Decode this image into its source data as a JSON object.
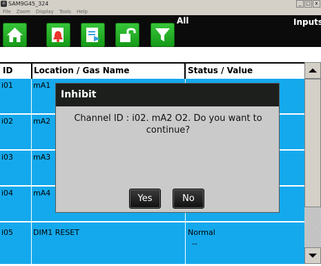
{
  "window": {
    "title": "SAM9G45_324",
    "minimize": "_",
    "maximize": "□",
    "close": "x"
  },
  "menu": [
    "File",
    "Zoom",
    "Display",
    "Tools",
    "Help"
  ],
  "toolbar": {
    "icons": [
      "home-icon",
      "alarm-bell-icon",
      "export-document-icon",
      "unlock-icon",
      "filter-icon"
    ],
    "filter_label": "All",
    "section_label": "Inputs"
  },
  "table": {
    "headers": [
      "ID",
      "Location / Gas Name",
      "Status / Value"
    ],
    "rows": [
      {
        "id": "i01",
        "name": "mA1",
        "status": "",
        "value": ""
      },
      {
        "id": "i02",
        "name": "mA2",
        "status": "",
        "value": ""
      },
      {
        "id": "i03",
        "name": "mA3",
        "status": "",
        "value": ""
      },
      {
        "id": "i04",
        "name": "mA4",
        "status": "",
        "value": ""
      },
      {
        "id": "i05",
        "name": "DIM1 RESET",
        "status": "Normal",
        "value": "--"
      }
    ]
  },
  "dialog": {
    "title": "Inhibit",
    "message": "Channel ID : i02. mA2 O2. Do you want to continue?",
    "yes_label": "Yes",
    "no_label": "No"
  },
  "colors": {
    "toolbar_bg": "#0b0b0b",
    "button_green": "#24b027",
    "row_blue": "#14a9ec",
    "dialog_bg": "#c9cac9",
    "dialog_title_bg": "#1d1f1d"
  }
}
